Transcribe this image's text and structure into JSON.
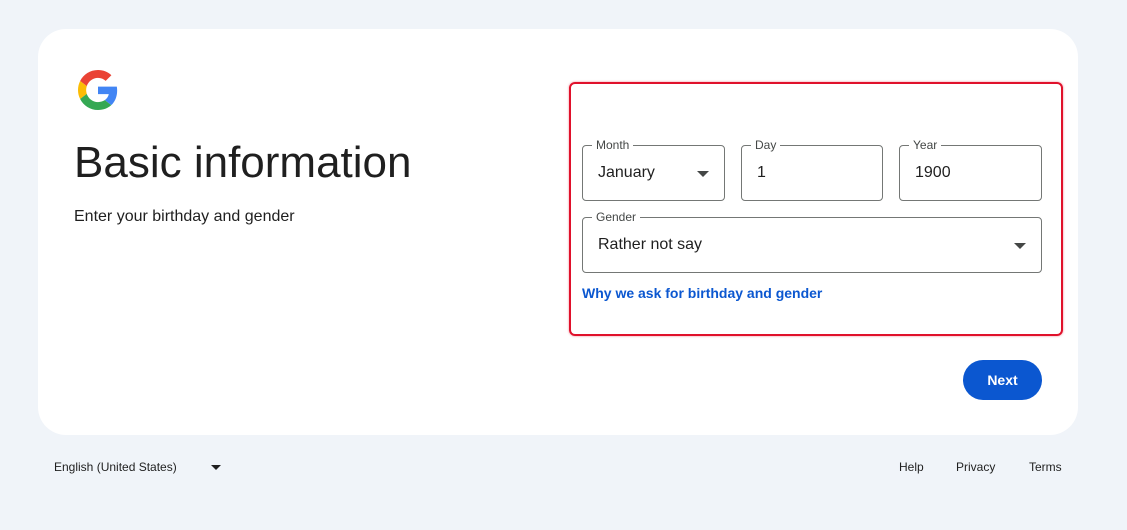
{
  "header": {
    "logo_icon": "google-g-logo-icon",
    "title": "Basic information",
    "subtitle": "Enter your birthday and gender"
  },
  "form": {
    "month": {
      "label": "Month",
      "value": "January",
      "icon": "caret-down-icon"
    },
    "day": {
      "label": "Day",
      "value": "1"
    },
    "year": {
      "label": "Year",
      "value": "1900"
    },
    "gender": {
      "label": "Gender",
      "value": "Rather not say",
      "icon": "caret-down-icon"
    },
    "why_link": "Why we ask for birthday and gender",
    "next_label": "Next"
  },
  "footer": {
    "language": "English (United States)",
    "help": "Help",
    "privacy": "Privacy",
    "terms": "Terms"
  },
  "colors": {
    "page_background": "#f0f4f9",
    "card_background": "#ffffff",
    "primary": "#0b57d0",
    "highlight_border": "#e0112b",
    "field_border": "#747775"
  }
}
